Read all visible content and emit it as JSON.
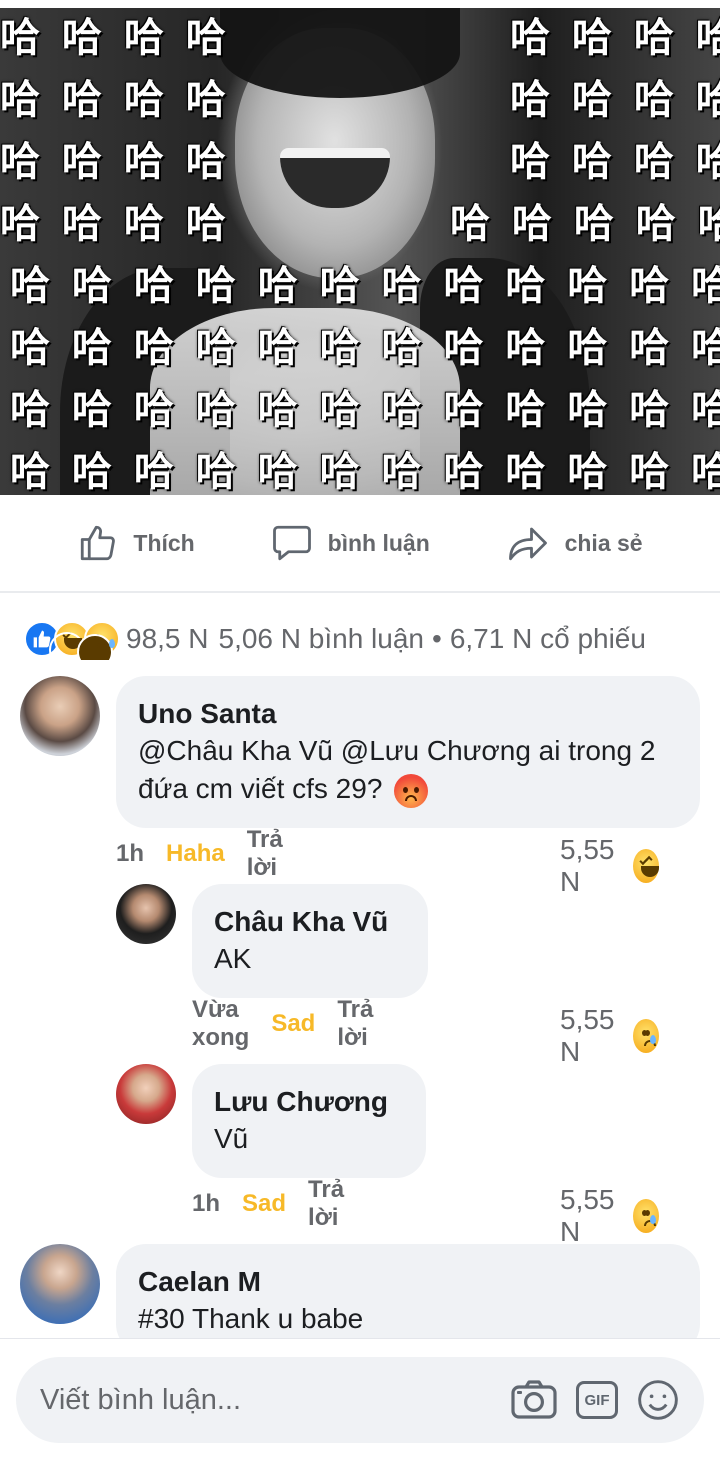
{
  "post": {
    "image_overlay_glyph": "哈"
  },
  "actions": {
    "like_label": "Thích",
    "comment_label": "bình luận",
    "share_label": "chia sẻ"
  },
  "summary": {
    "reactions_count": "98,5 N",
    "comments_text": "5,06 N  bình luận",
    "shares_text": "6,71 N  cổ phiếu",
    "separator": "•"
  },
  "comments": [
    {
      "author": "Uno Santa",
      "text": "@Châu Kha Vũ @Lưu Chương ai trong 2 đứa cm viết cfs 29?",
      "time": "1h",
      "reaction_label": "Haha",
      "reply_label": "Trả lời",
      "reaction_count": "5,55 N",
      "reaction_icon": "haha-icon",
      "inline_emoji": "angry-icon"
    },
    {
      "author": "Châu Kha Vũ",
      "text": "AK",
      "time": "Vừa xong",
      "reaction_label": "Sad",
      "reply_label": "Trả lời",
      "reaction_count": "5,55 N",
      "reaction_icon": "sad-icon"
    },
    {
      "author": "Lưu Chương",
      "text": "Vũ",
      "time": "1h",
      "reaction_label": "Sad",
      "reply_label": "Trả lời",
      "reaction_count": "5,55 N",
      "reaction_icon": "sad-icon"
    },
    {
      "author": "Caelan M",
      "text": "#30 Thank u babe"
    }
  ],
  "composer": {
    "placeholder": "Viết bình luận...",
    "gif_label": "GIF"
  },
  "colors": {
    "meta_gray": "#65676b",
    "bubble_bg": "#f0f2f5",
    "reaction_yellow": "#f7b928",
    "like_blue": "#1877f2"
  }
}
